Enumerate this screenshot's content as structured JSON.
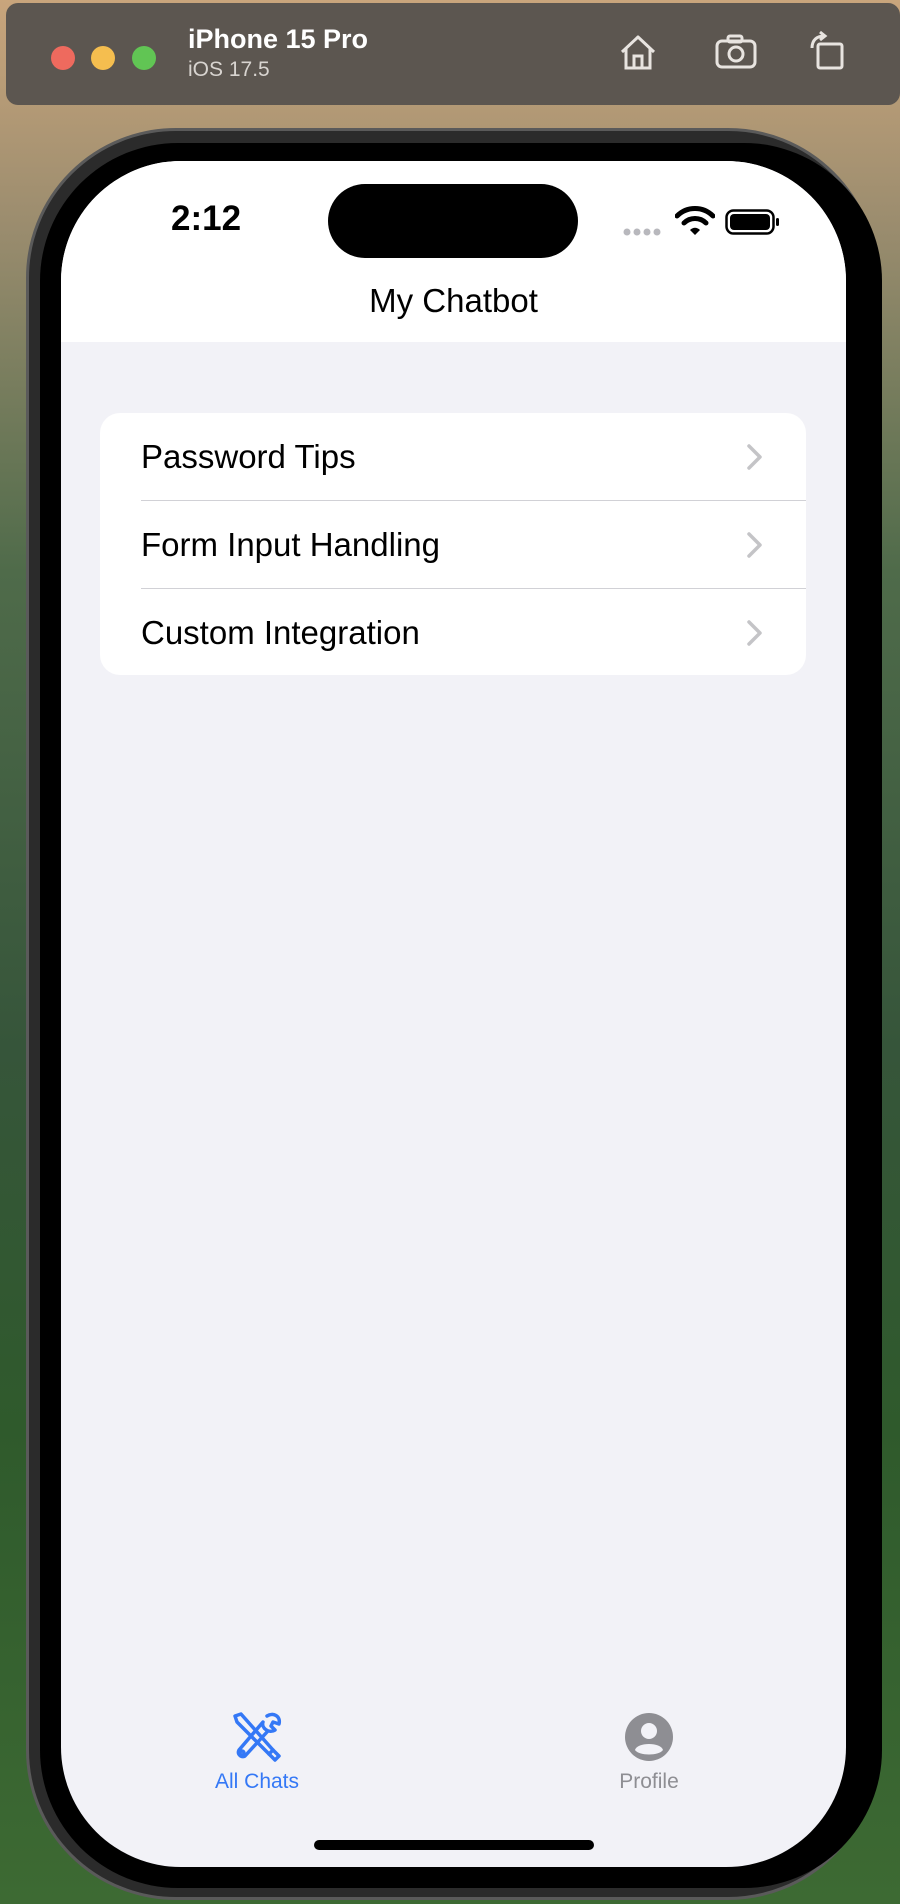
{
  "simulator": {
    "device_name": "iPhone 15 Pro",
    "os_version": "iOS 17.5",
    "tools": [
      "home-icon",
      "camera-icon",
      "rotate-icon"
    ]
  },
  "status_bar": {
    "time": "2:12"
  },
  "nav": {
    "title": "My Chatbot"
  },
  "chat_list": {
    "items": [
      {
        "label": "Password Tips"
      },
      {
        "label": "Form Input Handling"
      },
      {
        "label": "Custom Integration"
      }
    ]
  },
  "tab_bar": {
    "tabs": [
      {
        "label": "All Chats",
        "icon": "tools-icon",
        "selected": true
      },
      {
        "label": "Profile",
        "icon": "person-circle-icon",
        "selected": false
      }
    ]
  },
  "colors": {
    "accent": "#3478f6",
    "inactive": "#8e8e93",
    "background": "#f2f2f7"
  }
}
